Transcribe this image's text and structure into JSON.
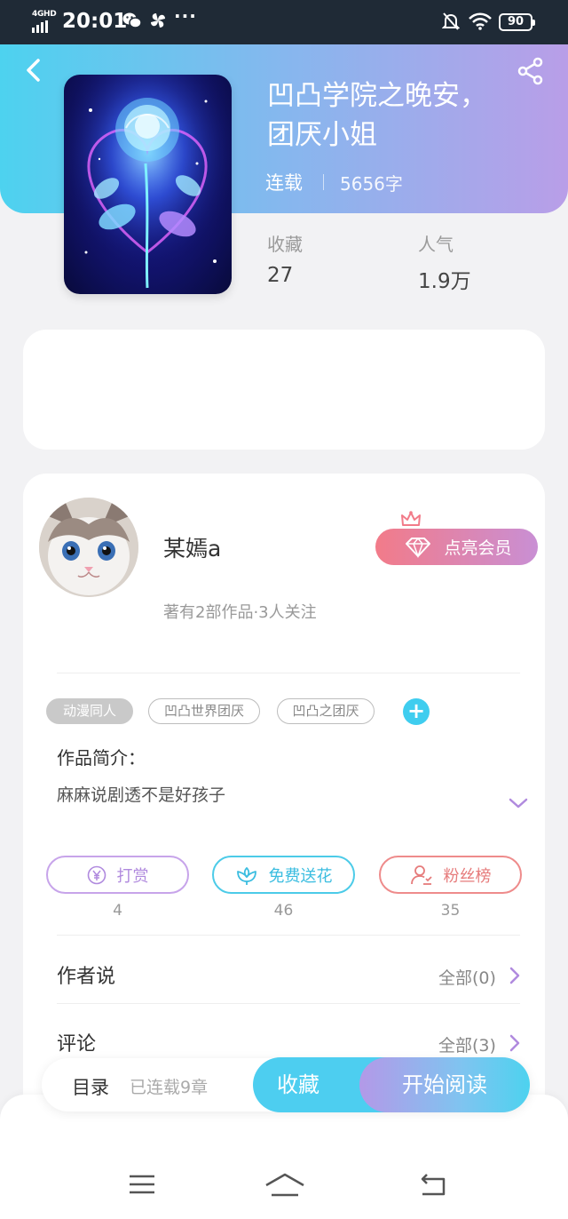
{
  "status_bar": {
    "network": "4GHD",
    "time": "20:01",
    "more": "···",
    "battery": "90"
  },
  "book": {
    "title_line1": "凹凸学院之晚安，",
    "title_line2": "团厌小姐",
    "status": "连载",
    "word_count": "5656字",
    "stats": {
      "favorites_label": "收藏",
      "favorites_value": "27",
      "popularity_label": "人气",
      "popularity_value": "1.9万"
    }
  },
  "author": {
    "name": "某嫣a",
    "meta": "著有2部作品·3人关注",
    "vip_button": "点亮会员"
  },
  "tags": [
    "动漫同人",
    "凹凸世界团厌",
    "凹凸之团厌"
  ],
  "tag_add": "+",
  "intro": {
    "title": "作品简介：",
    "text": "麻麻说剧透不是好孩子"
  },
  "actions": [
    {
      "label": "打赏",
      "count": "4",
      "icon": "yen-icon",
      "color": "#b08ade"
    },
    {
      "label": "免费送花",
      "count": "46",
      "icon": "flower-icon",
      "color": "#3bbde0"
    },
    {
      "label": "粉丝榜",
      "count": "35",
      "icon": "fan-ranking-icon",
      "color": "#e67b7b"
    }
  ],
  "sections": {
    "author_says_title": "作者说",
    "author_says_all": "全部(0)",
    "comments_title": "评论",
    "comments_all": "全部(3)"
  },
  "bottom_bar": {
    "toc": "目录",
    "chapters": "已连载9章",
    "collect": "收藏",
    "start_reading": "开始阅读"
  },
  "colors": {
    "accent_cyan": "#4dcef0",
    "accent_purple": "#b399e8",
    "vip_pink": "#f27b89"
  }
}
